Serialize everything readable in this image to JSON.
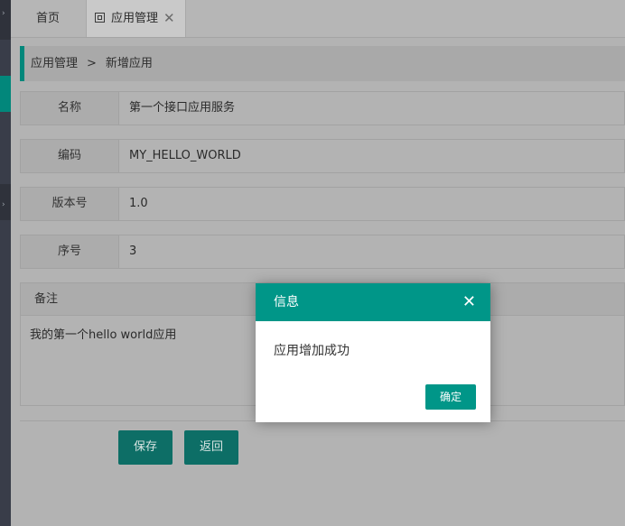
{
  "tabs": {
    "home_label": "首页",
    "app_label": "应用管理",
    "app_close": "✕"
  },
  "breadcrumb": {
    "parent": "应用管理",
    "separator": ">",
    "current": "新增应用"
  },
  "form": {
    "fields": [
      {
        "label": "名称",
        "value": "第一个接口应用服务"
      },
      {
        "label": "编码",
        "value": "MY_HELLO_WORLD"
      },
      {
        "label": "版本号",
        "value": "1.0"
      },
      {
        "label": "序号",
        "value": "3"
      }
    ],
    "remark_label": "备注",
    "remark_value": "我的第一个hello world应用",
    "save_label": "保存",
    "back_label": "返回"
  },
  "dialog": {
    "title": "信息",
    "close": "✕",
    "message": "应用增加成功",
    "confirm_label": "确定"
  },
  "colors": {
    "accent": "#009688",
    "sidebar": "#393d49"
  }
}
